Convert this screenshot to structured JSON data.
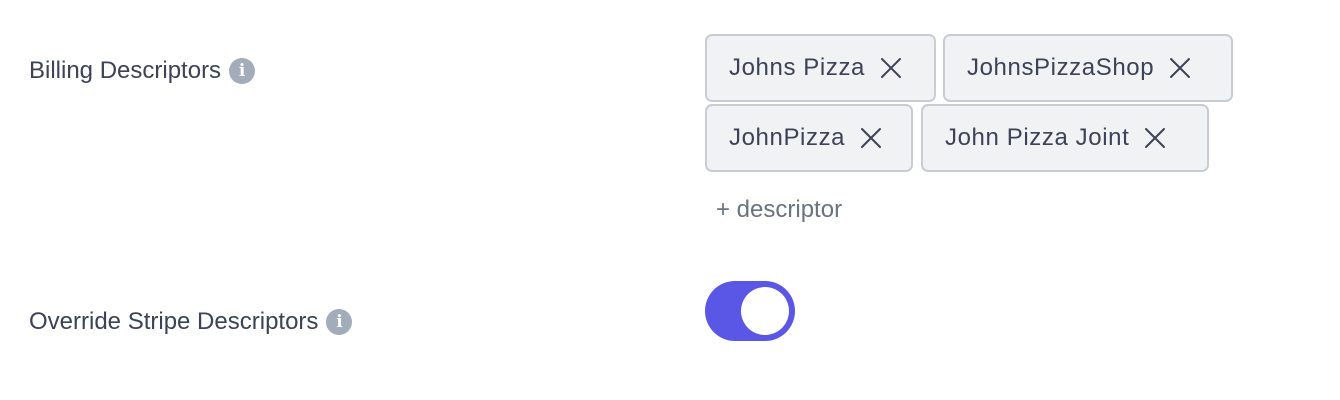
{
  "billing": {
    "label": "Billing Descriptors",
    "info_icon": "info-icon",
    "descriptors": [
      "Johns Pizza",
      "JohnsPizzaShop",
      "JohnPizza",
      "John Pizza Joint"
    ],
    "add_label": "+ descriptor"
  },
  "override": {
    "label": "Override Stripe Descriptors",
    "info_icon": "info-icon",
    "enabled": true
  },
  "colors": {
    "accent": "#5a56e6",
    "chip_bg": "#f1f2f4",
    "chip_border": "#c9cdd3",
    "text": "#3c4257",
    "muted": "#6b7280",
    "info_icon": "#a3acb9"
  }
}
